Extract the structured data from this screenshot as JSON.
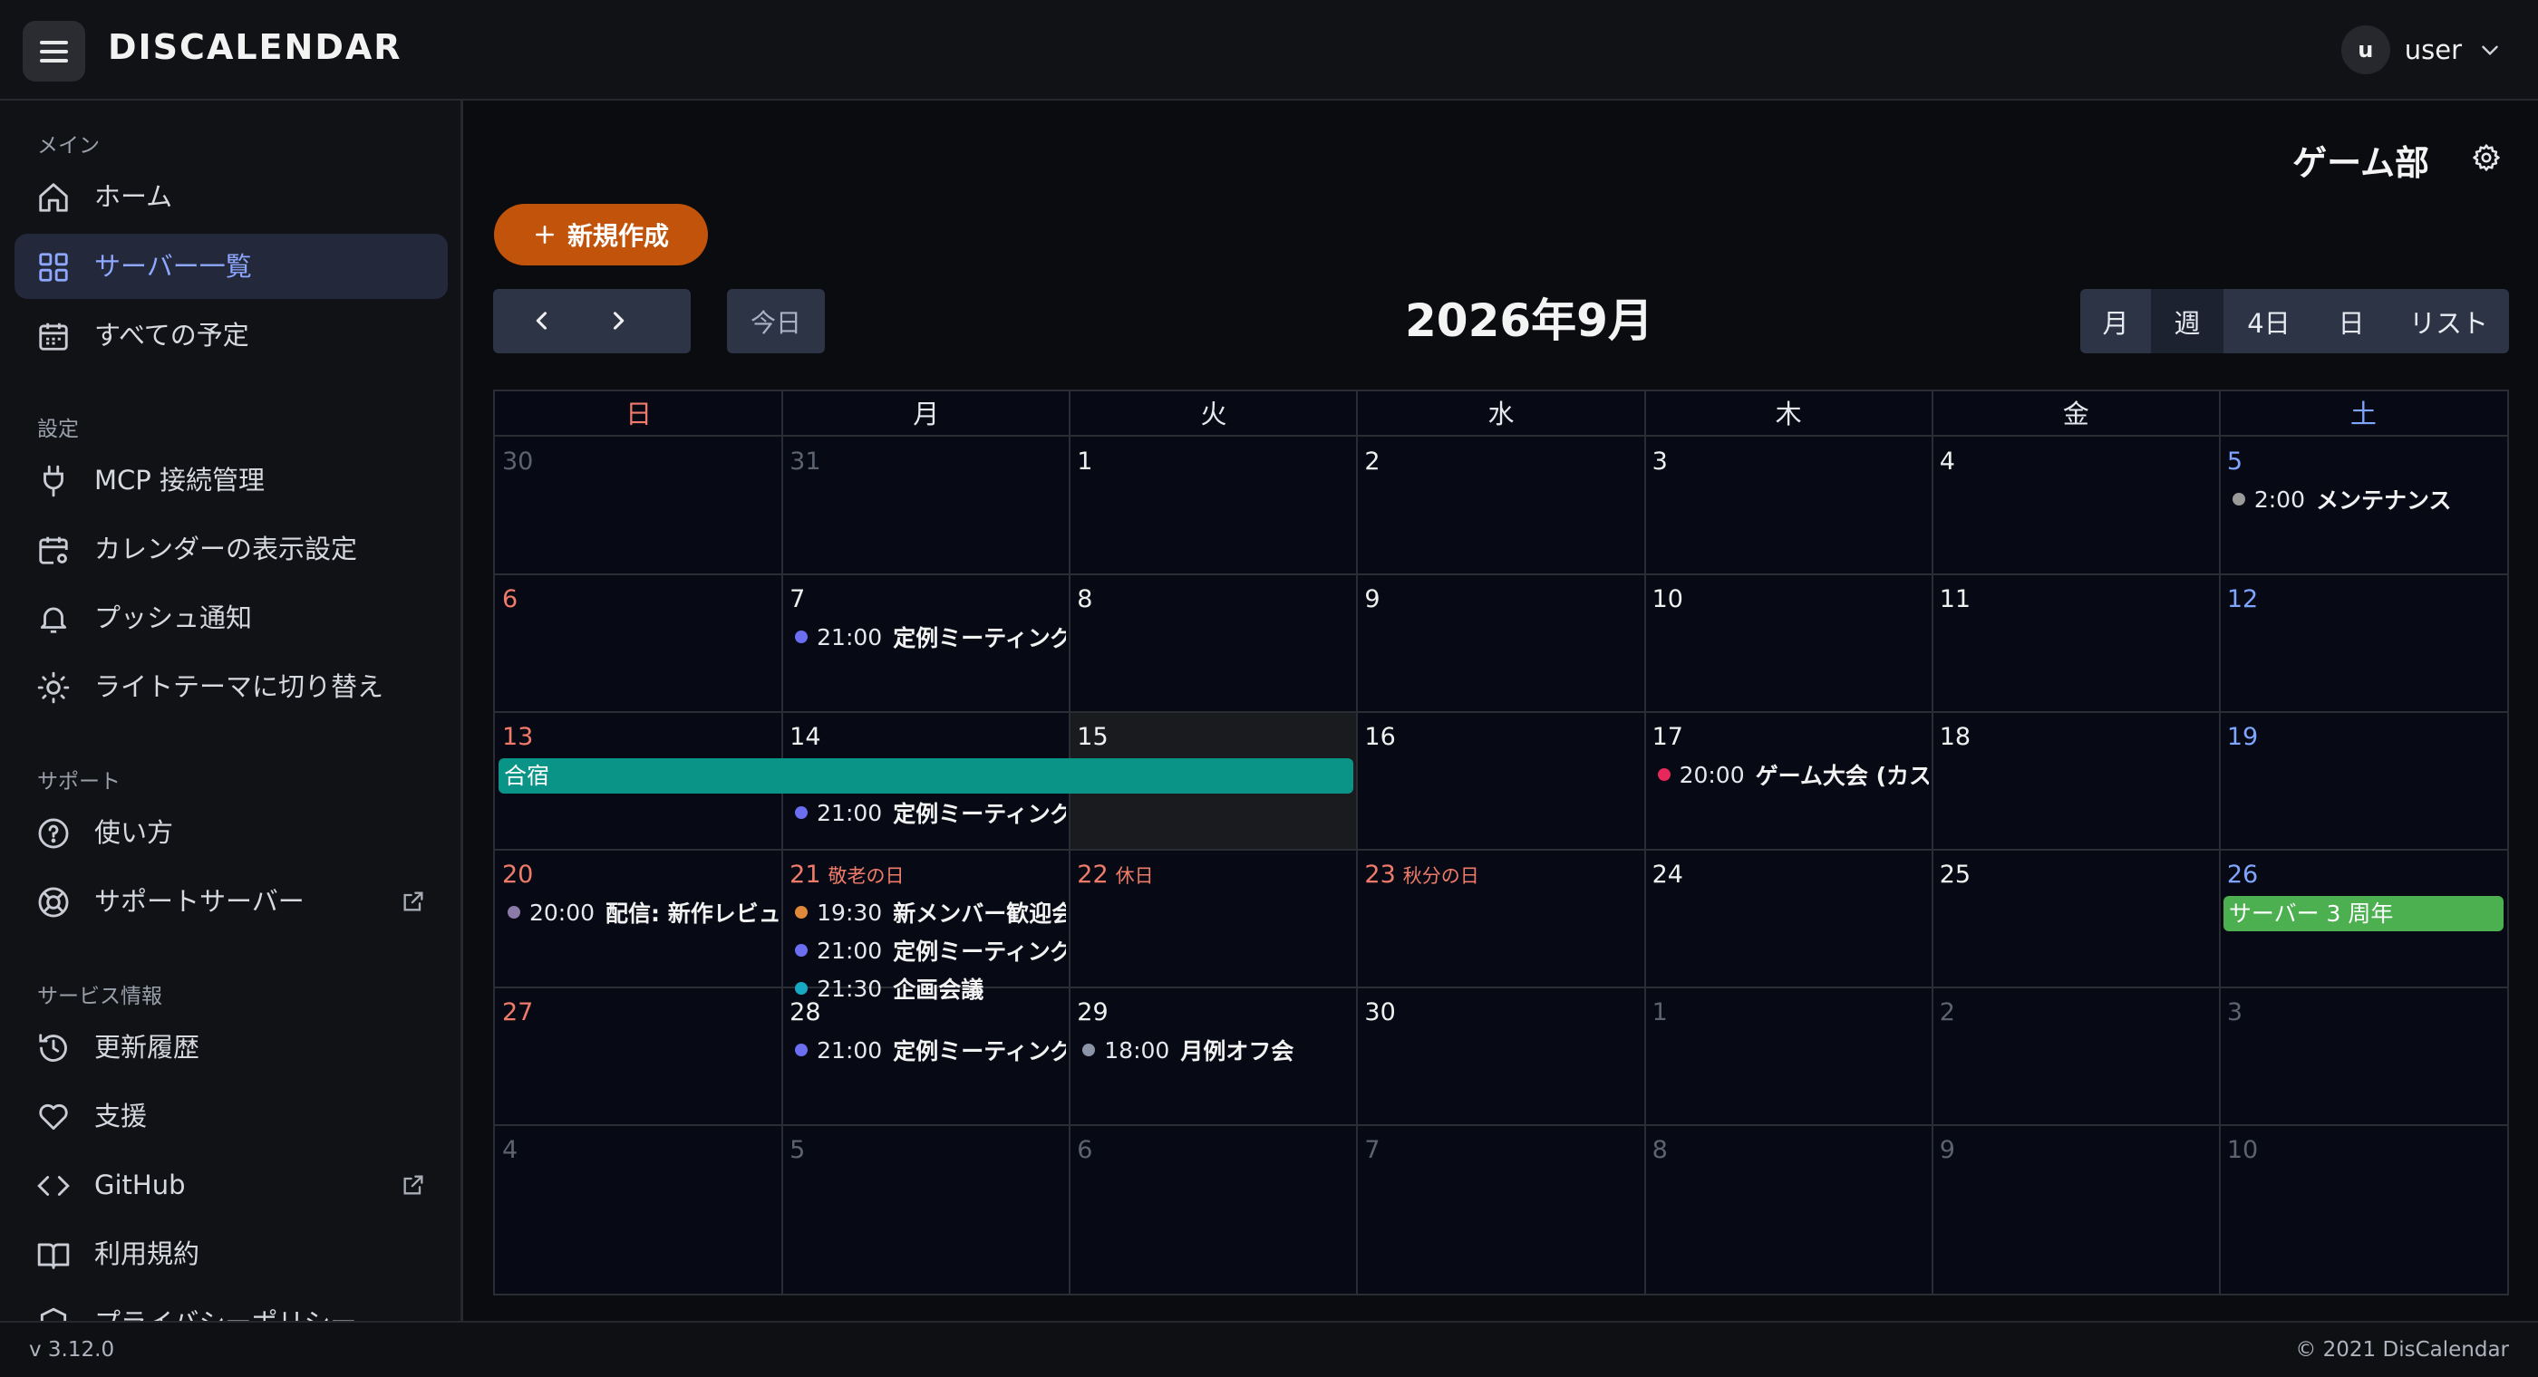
{
  "app": {
    "title": "DISCALENDAR"
  },
  "user": {
    "initial": "u",
    "name": "user"
  },
  "sidebar": {
    "sections": [
      {
        "label": "メイン"
      },
      {
        "label": "設定"
      },
      {
        "label": "サポート"
      },
      {
        "label": "サービス情報"
      }
    ],
    "items": [
      {
        "label": "ホーム",
        "icon": "home-icon"
      },
      {
        "label": "サーバー一覧",
        "icon": "grid-icon",
        "active": true
      },
      {
        "label": "すべての予定",
        "icon": "calendar-icon"
      },
      {
        "label": "MCP 接続管理",
        "icon": "plug-icon"
      },
      {
        "label": "カレンダーの表示設定",
        "icon": "calendar-settings-icon"
      },
      {
        "label": "プッシュ通知",
        "icon": "bell-icon"
      },
      {
        "label": "ライトテーマに切り替え",
        "icon": "sun-icon"
      },
      {
        "label": "使い方",
        "icon": "help-icon"
      },
      {
        "label": "サポートサーバー",
        "icon": "lifebuoy-icon",
        "external": true
      },
      {
        "label": "更新履歴",
        "icon": "history-icon"
      },
      {
        "label": "支援",
        "icon": "heart-icon"
      },
      {
        "label": "GitHub",
        "icon": "code-icon",
        "external": true
      },
      {
        "label": "利用規約",
        "icon": "book-icon"
      },
      {
        "label": "プライバシーポリシー",
        "icon": "shield-icon"
      }
    ]
  },
  "footer": {
    "version": "v 3.12.0",
    "copyright": "© 2021 DisCalendar"
  },
  "main": {
    "server_name": "ゲーム部",
    "new_button": "新規作成",
    "today_button": "今日",
    "calendar_title": "2026年9月",
    "views": [
      "月",
      "週",
      "4日",
      "日",
      "リスト"
    ],
    "active_view": "月"
  },
  "calendar": {
    "weekdays": [
      "日",
      "月",
      "火",
      "水",
      "木",
      "金",
      "土"
    ],
    "weeks": [
      [
        {
          "d": "30",
          "other": true
        },
        {
          "d": "31",
          "other": true
        },
        {
          "d": "1"
        },
        {
          "d": "2"
        },
        {
          "d": "3"
        },
        {
          "d": "4"
        },
        {
          "d": "5"
        }
      ],
      [
        {
          "d": "6"
        },
        {
          "d": "7"
        },
        {
          "d": "8"
        },
        {
          "d": "9"
        },
        {
          "d": "10"
        },
        {
          "d": "11"
        },
        {
          "d": "12"
        }
      ],
      [
        {
          "d": "13"
        },
        {
          "d": "14"
        },
        {
          "d": "15",
          "today": true
        },
        {
          "d": "16"
        },
        {
          "d": "17"
        },
        {
          "d": "18"
        },
        {
          "d": "19"
        }
      ],
      [
        {
          "d": "20"
        },
        {
          "d": "21",
          "holiday": "敬老の日"
        },
        {
          "d": "22",
          "holiday": "休日"
        },
        {
          "d": "23",
          "holiday": "秋分の日"
        },
        {
          "d": "24"
        },
        {
          "d": "25"
        },
        {
          "d": "26"
        }
      ],
      [
        {
          "d": "27"
        },
        {
          "d": "28"
        },
        {
          "d": "29"
        },
        {
          "d": "30"
        },
        {
          "d": "1",
          "other": true
        },
        {
          "d": "2",
          "other": true
        },
        {
          "d": "3",
          "other": true
        }
      ],
      [
        {
          "d": "4",
          "other": true
        },
        {
          "d": "5",
          "other": true
        },
        {
          "d": "6",
          "other": true
        },
        {
          "d": "7",
          "other": true
        },
        {
          "d": "8",
          "other": true
        },
        {
          "d": "9",
          "other": true
        },
        {
          "d": "10",
          "other": true
        }
      ]
    ],
    "events": [
      {
        "week": 0,
        "day": 6,
        "slot": 0,
        "time": "2:00",
        "title": "メンテナンス",
        "color": "#9a9a9a"
      },
      {
        "week": 1,
        "day": 1,
        "slot": 0,
        "time": "21:00",
        "title": "定例ミーティング",
        "color": "#6b6ef0"
      },
      {
        "week": 2,
        "day": 1,
        "slot": 1,
        "time": "21:00",
        "title": "定例ミーティング",
        "color": "#6b6ef0"
      },
      {
        "week": 2,
        "day": 4,
        "slot": 0,
        "time": "20:00",
        "title": "ゲーム大会 (カスタム)",
        "color": "#e8285a"
      },
      {
        "week": 3,
        "day": 0,
        "slot": 0,
        "time": "20:00",
        "title": "配信: 新作レビュー",
        "color": "#8c7aa8"
      },
      {
        "week": 3,
        "day": 1,
        "slot": 0,
        "time": "19:30",
        "title": "新メンバー歓迎会",
        "color": "#e0893b"
      },
      {
        "week": 3,
        "day": 1,
        "slot": 1,
        "time": "21:00",
        "title": "定例ミーティング",
        "color": "#6b6ef0"
      },
      {
        "week": 3,
        "day": 1,
        "slot": 2,
        "time": "21:30",
        "title": "企画会議",
        "color": "#17a9c4"
      },
      {
        "week": 4,
        "day": 1,
        "slot": 0,
        "time": "21:00",
        "title": "定例ミーティング",
        "color": "#6b6ef0"
      },
      {
        "week": 4,
        "day": 2,
        "slot": 0,
        "time": "18:00",
        "title": "月例オフ会",
        "color": "#8c95a8"
      }
    ],
    "bars": [
      {
        "week": 2,
        "start": 0,
        "span": 3,
        "title": "合宿",
        "color": "#0a9487"
      },
      {
        "week": 3,
        "start": 6,
        "span": 1,
        "title": "サーバー 3 周年",
        "color": "#4caf50"
      }
    ]
  }
}
